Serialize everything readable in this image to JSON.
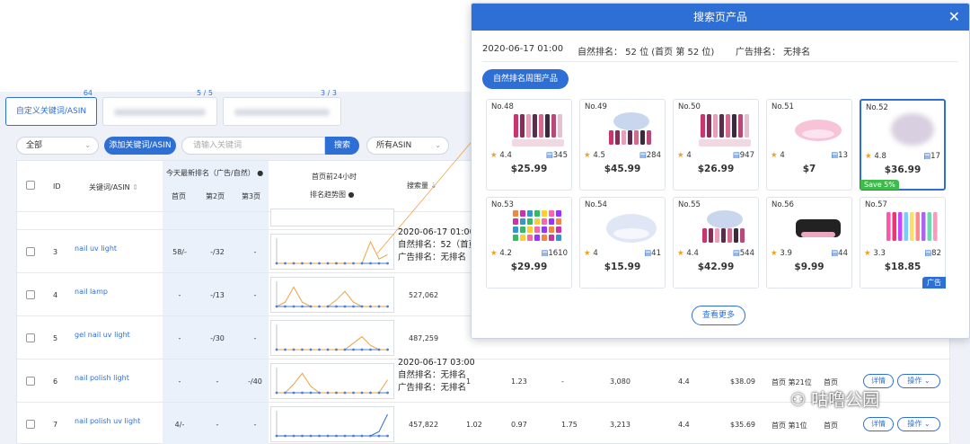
{
  "tabs": [
    {
      "label": "自定义关键词/ASIN",
      "count": "64"
    },
    {
      "label": "",
      "count": "5 / 5"
    },
    {
      "label": "",
      "count": "3 / 3"
    }
  ],
  "toolbar": {
    "filter": "全部",
    "add_label": "添加关键词/ASIN",
    "search_placeholder": "请输入关键词",
    "search_label": "搜索",
    "asin_filter": "所有ASIN"
  },
  "table": {
    "headers": {
      "id": "ID",
      "keyword": "关键词/ASIN",
      "today_rank": "今天最新排名（广告/自然）",
      "page1": "首页",
      "page2": "第2页",
      "page3": "第3页",
      "trend_line1": "首页前24小时",
      "trend_line2": "排名趋势图",
      "volume": "搜索量"
    },
    "rows": [
      {
        "id": "3",
        "keyword": "nail uv light",
        "p1": "58/-",
        "p2": "-/32",
        "p3": "-",
        "volume": ""
      },
      {
        "id": "4",
        "keyword": "nail lamp",
        "p1": "-",
        "p2": "-/13",
        "p3": "-",
        "volume": "527,062"
      },
      {
        "id": "5",
        "keyword": "gel nail uv light",
        "p1": "-",
        "p2": "-/30",
        "p3": "-",
        "volume": "487,259"
      },
      {
        "id": "6",
        "keyword": "nail polish light",
        "p1": "-",
        "p2": "-",
        "p3": "-/40",
        "volume": "",
        "c1": "1",
        "c2": "1.23",
        "c3": "-",
        "c4": "3,080",
        "c5": "4.4",
        "c6": "$38.09",
        "c7": "首页 第21位",
        "c8": "首页"
      },
      {
        "id": "7",
        "keyword": "nail polish uv light",
        "p1": "4/-",
        "p2": "-",
        "p3": "-",
        "volume": "457,822",
        "c1": "1.02",
        "c2": "0.97",
        "c3": "1.75",
        "c4": "3,213",
        "c5": "4.4",
        "c6": "$35.69",
        "c7": "首页 第1位",
        "c8": "首页"
      }
    ],
    "detail_label": "详情",
    "ops_label": "操作"
  },
  "tooltip_row3": {
    "time": "2020-06-17 01:00",
    "natural": "自然排名：52（首页",
    "ad": "广告排名：无排名"
  },
  "tooltip_row6": {
    "time": "2020-06-17 03:00",
    "natural": "自然排名：无排名",
    "ad": "广告排名：无排名"
  },
  "modal": {
    "title": "搜索页产品",
    "time": "2020-06-17 01:00",
    "natural": "自然排名： 52 位 (首页 第 52 位)",
    "ad": "广告排名： 无排名",
    "periph_label": "自然排名周围产品",
    "more_label": "查看更多",
    "products": [
      {
        "no": "No.48",
        "rating": "4.4",
        "reviews": "345",
        "price": "$25.99",
        "img": "polish-set"
      },
      {
        "no": "No.49",
        "rating": "4.5",
        "reviews": "284",
        "price": "$45.99",
        "img": "lamp-kit"
      },
      {
        "no": "No.50",
        "rating": "4",
        "reviews": "947",
        "price": "$26.99",
        "img": "polish-set"
      },
      {
        "no": "No.51",
        "rating": "4",
        "reviews": "13",
        "price": "$7",
        "img": "pink-lamp"
      },
      {
        "no": "No.52",
        "rating": "4.8",
        "reviews": "17",
        "price": "$36.99",
        "img": "blurred",
        "badge": "Save 5%"
      },
      {
        "no": "No.53",
        "rating": "4.2",
        "reviews": "1610",
        "price": "$29.99",
        "img": "color-grid"
      },
      {
        "no": "No.54",
        "rating": "4",
        "reviews": "41",
        "price": "$15.99",
        "img": "white-lamp"
      },
      {
        "no": "No.55",
        "rating": "4.4",
        "reviews": "544",
        "price": "$42.99",
        "img": "lamp-kit"
      },
      {
        "no": "No.56",
        "rating": "3.9",
        "reviews": "44",
        "price": "$9.99",
        "img": "black-lamp"
      },
      {
        "no": "No.57",
        "rating": "3.3",
        "reviews": "82",
        "price": "$18.85",
        "img": "bottles",
        "ad": "广告"
      }
    ]
  },
  "watermark": "咕噜公园"
}
